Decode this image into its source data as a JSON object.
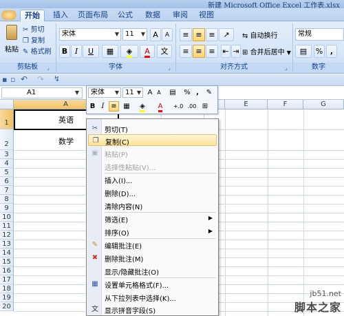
{
  "window": {
    "title": "新建 Microsoft Office Excel 工作表.xlsx"
  },
  "tabs": [
    "开始",
    "插入",
    "页面布局",
    "公式",
    "数据",
    "审阅",
    "视图"
  ],
  "clipboard": {
    "paste": "粘贴",
    "cut": "剪切",
    "copy": "复制",
    "format_painter": "格式刷",
    "group": "剪贴板"
  },
  "font": {
    "name": "宋体",
    "size": "11",
    "grow": "A",
    "shrink": "A",
    "bold": "B",
    "italic": "I",
    "underline": "U",
    "group": "字体"
  },
  "alignment": {
    "wrap": "自动换行",
    "merge": "合并后居中",
    "group": "对齐方式"
  },
  "number": {
    "format": "常规",
    "percent": "%",
    "comma": ",",
    "group": "数字"
  },
  "formula_bar": {
    "name_box": "A1"
  },
  "columns": [
    "A",
    "B",
    "C",
    "D",
    "E",
    "F",
    "G"
  ],
  "rows": [
    "1",
    "2",
    "3",
    "4",
    "5",
    "6",
    "7",
    "8",
    "9",
    "10",
    "11",
    "12",
    "13",
    "14",
    "15",
    "16",
    "17",
    "18",
    "19",
    "20"
  ],
  "cells": {
    "A1": "英语",
    "A2": "数学"
  },
  "mini_toolbar": {
    "font": "宋体",
    "size": "11",
    "grow": "A",
    "shrink": "A",
    "percent": "%",
    "comma": ",",
    "bold": "B",
    "italic": "I",
    "font_color": "A",
    "dec_inc": "+.0",
    "dec_dec": ".00"
  },
  "context_menu": [
    {
      "label": "剪切(T)",
      "icon": "scissors-icon",
      "state": "normal"
    },
    {
      "label": "复制(C)",
      "icon": "copy-icon",
      "state": "hover"
    },
    {
      "label": "粘贴(P)",
      "icon": "paste-icon",
      "state": "disabled"
    },
    {
      "label": "选择性粘贴(V)...",
      "icon": "",
      "state": "disabled"
    },
    {
      "label": "插入(I)...",
      "icon": "",
      "state": "normal"
    },
    {
      "label": "删除(D)...",
      "icon": "",
      "state": "normal"
    },
    {
      "label": "清除内容(N)",
      "icon": "",
      "state": "normal"
    },
    {
      "label": "筛选(E)",
      "icon": "",
      "state": "submenu"
    },
    {
      "label": "排序(O)",
      "icon": "",
      "state": "submenu"
    },
    {
      "label": "编辑批注(E)",
      "icon": "edit-comment-icon",
      "state": "normal"
    },
    {
      "label": "删除批注(M)",
      "icon": "delete-comment-icon",
      "state": "normal"
    },
    {
      "label": "显示/隐藏批注(O)",
      "icon": "",
      "state": "normal"
    },
    {
      "label": "设置单元格格式(F)...",
      "icon": "format-cells-icon",
      "state": "normal"
    },
    {
      "label": "从下拉列表中选择(K)...",
      "icon": "",
      "state": "normal"
    },
    {
      "label": "显示拼音字段(S)",
      "icon": "phonetic-icon",
      "state": "normal"
    }
  ],
  "watermark": {
    "site": "jb51.net",
    "brand": "脚本之家"
  },
  "colors": {
    "ribbon": "#d4e4f8",
    "highlight": "#ffd36b",
    "selection": "#f1c15f"
  }
}
